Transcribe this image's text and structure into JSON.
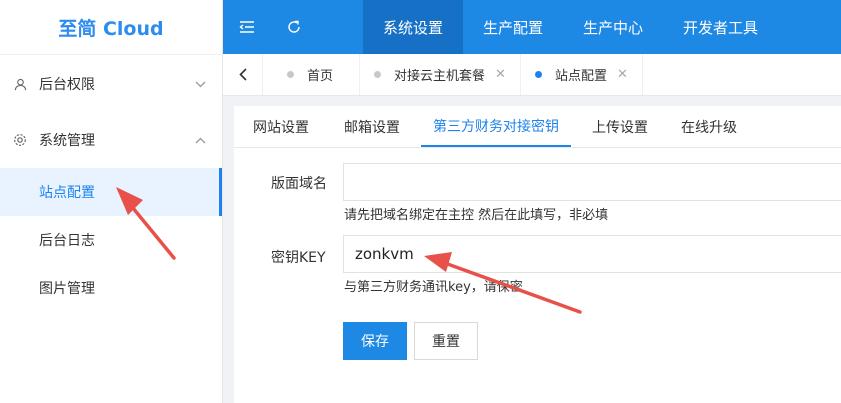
{
  "app": {
    "logo": "至简 Cloud"
  },
  "sidebar": {
    "groups": [
      {
        "label": "后台权限",
        "icon": "user-icon",
        "expanded": false
      },
      {
        "label": "系统管理",
        "icon": "gear-icon",
        "expanded": true
      }
    ],
    "items": [
      {
        "label": "站点配置",
        "active": true
      },
      {
        "label": "后台日志",
        "active": false
      },
      {
        "label": "图片管理",
        "active": false
      }
    ]
  },
  "header": {
    "nav": [
      {
        "label": "系统设置",
        "active": true
      },
      {
        "label": "生产配置",
        "active": false
      },
      {
        "label": "生产中心",
        "active": false
      },
      {
        "label": "开发者工具",
        "active": false
      }
    ]
  },
  "tabs": [
    {
      "label": "首页",
      "active": false,
      "closable": false
    },
    {
      "label": "对接云主机套餐",
      "active": false,
      "closable": true
    },
    {
      "label": "站点配置",
      "active": true,
      "closable": true
    }
  ],
  "subtabs": [
    {
      "label": "网站设置",
      "active": false
    },
    {
      "label": "邮箱设置",
      "active": false
    },
    {
      "label": "第三方财务对接密钥",
      "active": true
    },
    {
      "label": "上传设置",
      "active": false
    },
    {
      "label": "在线升级",
      "active": false
    }
  ],
  "form": {
    "domain": {
      "label": "版面域名",
      "value": "",
      "hint": "请先把域名绑定在主控 然后在此填写，非必填"
    },
    "key": {
      "label": "密钥KEY",
      "value": "zonkvm",
      "hint": "与第三方财务通讯key，请保密"
    },
    "save_label": "保存",
    "reset_label": "重置"
  },
  "colors": {
    "accent": "#1e88e5",
    "annotation": "#e8504a"
  }
}
